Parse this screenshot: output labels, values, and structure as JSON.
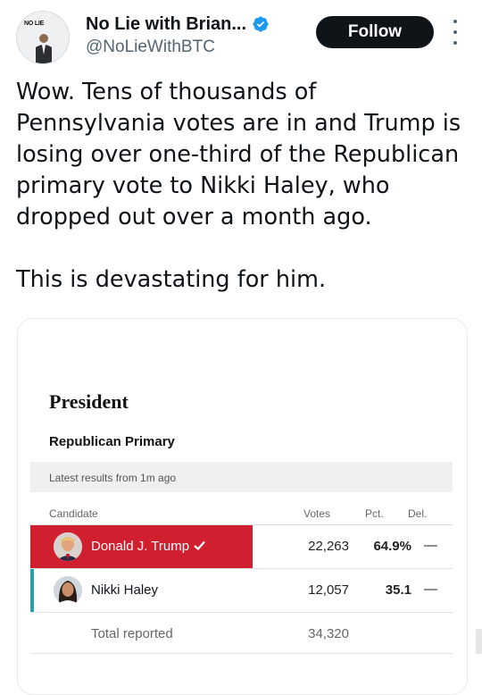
{
  "author": {
    "name": "No Lie with Brian...",
    "handle": "@NoLieWithBTC",
    "avatar_logo": "NO LIE",
    "avatar_logo_sub": "BRIAN TYLER COHEN",
    "verified_color": "#1d9bf0"
  },
  "follow_label": "Follow",
  "tweet": {
    "paragraphs": [
      "Wow. Tens of thousands of Pennsylvania votes are in and Trump is losing over one-third of the Republican primary vote to Nikki Haley, who dropped out over a month ago.",
      "This is devastating for him."
    ]
  },
  "results_card": {
    "title": "President",
    "subtitle": "Republican Primary",
    "latest": "Latest results from 1m ago",
    "columns": {
      "candidate": "Candidate",
      "votes": "Votes",
      "pct": "Pct.",
      "del": "Del."
    },
    "candidates": [
      {
        "name": "Donald J. Trump",
        "votes": "22,263",
        "pct": "64.9%",
        "del": "—",
        "winner": true,
        "color": "#d0202f"
      },
      {
        "name": "Nikki Haley",
        "votes": "12,057",
        "pct": "35.1",
        "del": "—",
        "winner": false,
        "color": "#27a3a6"
      }
    ],
    "total_label": "Total reported",
    "total_votes": "34,320"
  },
  "icons": [
    "verified-badge-icon",
    "more-options-icon",
    "checkmark-icon"
  ]
}
